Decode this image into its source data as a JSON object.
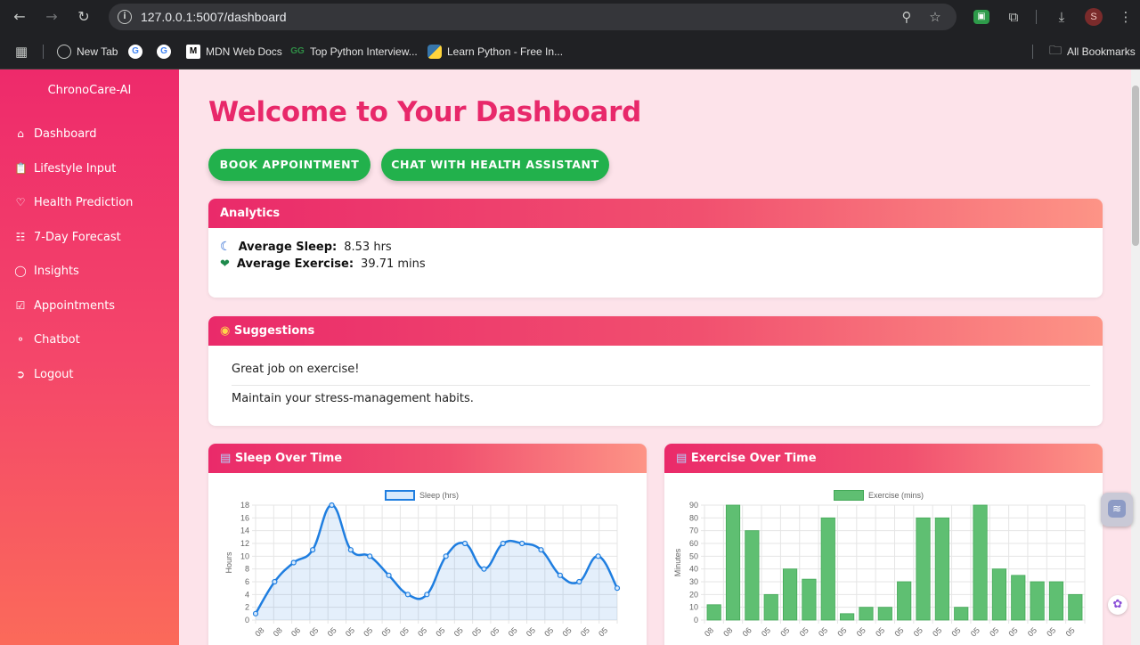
{
  "browser": {
    "url": "127.0.0.1:5007/dashboard",
    "profile_initial": "S",
    "bookmarks": [
      "New Tab",
      "MDN Web Docs",
      "Top Python Interview...",
      "Learn Python - Free In..."
    ],
    "all_bookmarks": "All Bookmarks"
  },
  "sidebar": {
    "brand": "ChronoCare-AI",
    "items": [
      {
        "label": "Dashboard",
        "icon": "home-icon"
      },
      {
        "label": "Lifestyle Input",
        "icon": "clipboard-icon"
      },
      {
        "label": "Health Prediction",
        "icon": "heart-pulse-icon"
      },
      {
        "label": "7-Day Forecast",
        "icon": "calendar-icon"
      },
      {
        "label": "Insights",
        "icon": "lightbulb-icon"
      },
      {
        "label": "Appointments",
        "icon": "calendar-check-icon"
      },
      {
        "label": "Chatbot",
        "icon": "chat-icon"
      },
      {
        "label": "Logout",
        "icon": "logout-icon"
      }
    ]
  },
  "main": {
    "title": "Welcome to Your Dashboard",
    "buttons": {
      "book": "BOOK APPOINTMENT",
      "chat": "CHAT WITH HEALTH ASSISTANT"
    },
    "analytics": {
      "header": "Analytics",
      "sleep_label": "Average Sleep:",
      "sleep_value": "8.53 hrs",
      "exercise_label": "Average Exercise:",
      "exercise_value": "39.71 mins"
    },
    "suggestions": {
      "header": "Suggestions",
      "items": [
        "Great job on exercise!",
        "Maintain your stress-management habits."
      ]
    },
    "sleep_card_header": "Sleep Over Time",
    "exercise_card_header": "Exercise Over Time"
  },
  "colors": {
    "accent": "#e8286a",
    "button_green": "#22b14c",
    "sleep_line": "#1f7ee0",
    "exercise_bar": "#5fbf72"
  },
  "chart_data": [
    {
      "type": "line",
      "legend": "Sleep (hrs)",
      "ylabel": "Hours",
      "ylim": [
        0,
        18
      ],
      "yticks": [
        0,
        2,
        4,
        6,
        8,
        10,
        12,
        14,
        16,
        18
      ],
      "x_ticks": [
        "08",
        "08",
        "06",
        "05",
        "05",
        "05",
        "05",
        "05",
        "05",
        "05",
        "05",
        "05",
        "05",
        "05",
        "05",
        "05",
        "05",
        "05",
        "05",
        "05"
      ],
      "values": [
        1,
        6,
        9,
        11,
        18,
        11,
        10,
        7,
        4,
        4,
        10,
        12,
        8,
        12,
        12,
        11,
        7,
        6,
        10,
        5
      ]
    },
    {
      "type": "bar",
      "legend": "Exercise (mins)",
      "ylabel": "Minutes",
      "ylim": [
        0,
        90
      ],
      "yticks": [
        0,
        10,
        20,
        30,
        40,
        50,
        60,
        70,
        80,
        90
      ],
      "x_ticks": [
        "08",
        "08",
        "06",
        "05",
        "05",
        "05",
        "05",
        "05",
        "05",
        "05",
        "05",
        "05",
        "05",
        "05",
        "05",
        "05",
        "05",
        "05",
        "05",
        "05"
      ],
      "values": [
        12,
        90,
        70,
        20,
        40,
        32,
        80,
        5,
        10,
        10,
        30,
        80,
        80,
        10,
        90,
        40,
        35,
        30,
        30,
        20
      ]
    }
  ]
}
